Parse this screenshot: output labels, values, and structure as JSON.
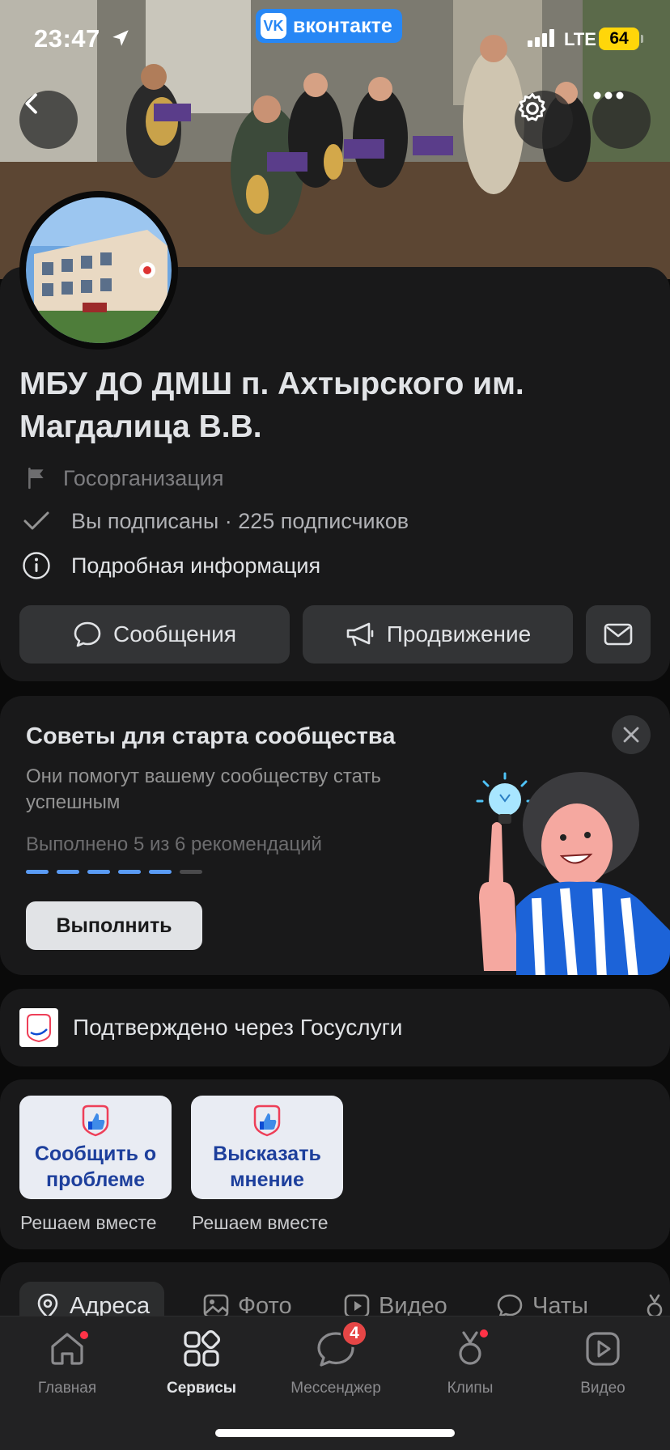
{
  "status_bar": {
    "time": "23:47",
    "network": "LTE",
    "battery": "64"
  },
  "vk_pill": {
    "label": "вконтакте",
    "logo": "VK"
  },
  "community": {
    "name": "МБУ ДО ДМШ п. Ахтырского им. Магдалица В.В.",
    "type": "Госорганизация",
    "subscription": "Вы подписаны · 225 подписчиков",
    "details": "Подробная информация"
  },
  "actions": {
    "messages": "Сообщения",
    "promotion": "Продвижение"
  },
  "tips": {
    "title": "Советы для старта сообщества",
    "subtitle": "Они помогут вашему сообществу стать успешным",
    "progress": "Выполнено 5 из 6 рекомендаций",
    "completed": 5,
    "total": 6,
    "button": "Выполнить"
  },
  "gosuslugi": {
    "text": "Подтверждено через Госуслуги",
    "logo_text": "гос услуги"
  },
  "widgets": [
    {
      "label": "Сообщить о проблеме",
      "caption": "Решаем вместе"
    },
    {
      "label": "Высказать мнение",
      "caption": "Решаем вместе"
    }
  ],
  "tabs": [
    {
      "label": "Адреса",
      "icon": "location-icon"
    },
    {
      "label": "Фото",
      "icon": "photo-icon"
    },
    {
      "label": "Видео",
      "icon": "video-icon"
    },
    {
      "label": "Чаты",
      "icon": "chat-icon"
    }
  ],
  "tabbar": [
    {
      "label": "Главная",
      "icon": "home-icon"
    },
    {
      "label": "Сервисы",
      "icon": "services-icon"
    },
    {
      "label": "Мессенджер",
      "icon": "messenger-icon",
      "badge": "4"
    },
    {
      "label": "Клипы",
      "icon": "clips-icon"
    },
    {
      "label": "Видео",
      "icon": "video-icon"
    }
  ],
  "colors": {
    "accent": "#2787f5",
    "card": "#19191a",
    "button": "#333436",
    "badge": "#e64646",
    "progress_done": "#5a9bf5"
  }
}
